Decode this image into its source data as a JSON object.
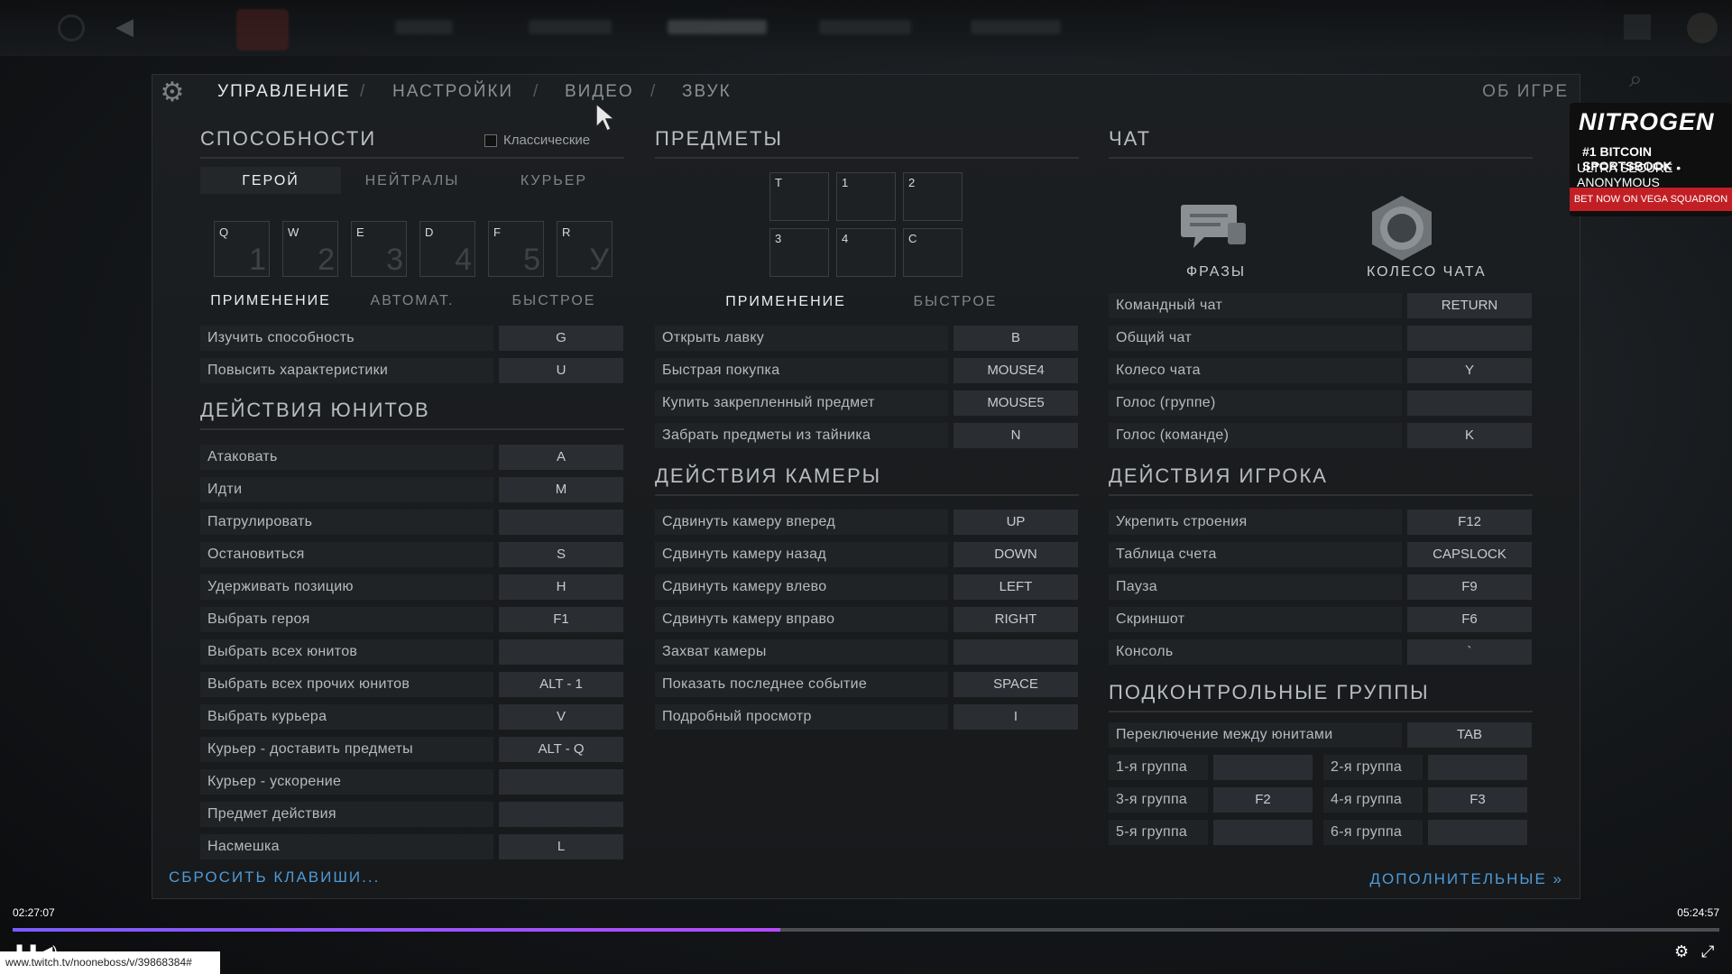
{
  "tabs": {
    "controls": "УПРАВЛЕНИЕ",
    "settings": "НАСТРОЙКИ",
    "video": "ВИДЕО",
    "sound": "ЗВУК",
    "about": "ОБ ИГРЕ",
    "sep": "/"
  },
  "abilities": {
    "title": "СПОСОБНОСТИ",
    "classic_label": "Классические",
    "hero_tabs": [
      "ГЕРОЙ",
      "НЕЙТРАЛЫ",
      "КУРЬЕР"
    ],
    "slots": [
      {
        "key": "Q",
        "num": "1"
      },
      {
        "key": "W",
        "num": "2"
      },
      {
        "key": "E",
        "num": "3"
      },
      {
        "key": "D",
        "num": "4"
      },
      {
        "key": "F",
        "num": "5"
      },
      {
        "key": "R",
        "num": "У"
      }
    ],
    "cast_tabs": [
      "ПРИМЕНЕНИЕ",
      "АВТОМАТ.",
      "БЫСТРОЕ"
    ],
    "rows": [
      {
        "label": "Изучить способность",
        "key": "G"
      },
      {
        "label": "Повысить характеристики",
        "key": "U"
      }
    ]
  },
  "unit_actions": {
    "title": "ДЕЙСТВИЯ ЮНИТОВ",
    "rows": [
      {
        "label": "Атаковать",
        "key": "A"
      },
      {
        "label": "Идти",
        "key": "M"
      },
      {
        "label": "Патрулировать",
        "key": ""
      },
      {
        "label": "Остановиться",
        "key": "S"
      },
      {
        "label": "Удерживать позицию",
        "key": "H"
      },
      {
        "label": "Выбрать героя",
        "key": "F1"
      },
      {
        "label": "Выбрать всех юнитов",
        "key": ""
      },
      {
        "label": "Выбрать всех прочих юнитов",
        "key": "ALT - 1"
      },
      {
        "label": "Выбрать курьера",
        "key": "V"
      },
      {
        "label": "Курьер - доставить предметы",
        "key": "ALT - Q"
      },
      {
        "label": "Курьер - ускорение",
        "key": ""
      },
      {
        "label": "Предмет действия",
        "key": ""
      },
      {
        "label": "Насмешка",
        "key": "L"
      }
    ]
  },
  "items": {
    "title": "ПРЕДМЕТЫ",
    "slots": [
      "T",
      "1",
      "2",
      "3",
      "4",
      "C"
    ],
    "cast_tabs": [
      "ПРИМЕНЕНИЕ",
      "БЫСТРОЕ"
    ],
    "rows": [
      {
        "label": "Открыть лавку",
        "key": "B"
      },
      {
        "label": "Быстрая покупка",
        "key": "MOUSE4"
      },
      {
        "label": "Купить закрепленный предмет",
        "key": "MOUSE5"
      },
      {
        "label": "Забрать предметы из тайника",
        "key": "N"
      }
    ]
  },
  "camera": {
    "title": "ДЕЙСТВИЯ КАМЕРЫ",
    "rows": [
      {
        "label": "Сдвинуть камеру вперед",
        "key": "UP"
      },
      {
        "label": "Сдвинуть камеру назад",
        "key": "DOWN"
      },
      {
        "label": "Сдвинуть камеру влево",
        "key": "LEFT"
      },
      {
        "label": "Сдвинуть камеру вправо",
        "key": "RIGHT"
      },
      {
        "label": "Захват камеры",
        "key": ""
      },
      {
        "label": "Показать последнее событие",
        "key": "SPACE"
      },
      {
        "label": "Подробный просмотр",
        "key": "I"
      }
    ]
  },
  "chat": {
    "title": "ЧАТ",
    "phrases_label": "ФРАЗЫ",
    "wheel_label": "КОЛЕСО ЧАТА",
    "rows": [
      {
        "label": "Командный чат",
        "key": "RETURN"
      },
      {
        "label": "Общий чат",
        "key": ""
      },
      {
        "label": "Колесо чата",
        "key": "Y"
      },
      {
        "label": "Голос (группе)",
        "key": ""
      },
      {
        "label": "Голос (команде)",
        "key": "K"
      }
    ]
  },
  "player_actions": {
    "title": "ДЕЙСТВИЯ ИГРОКА",
    "rows": [
      {
        "label": "Укрепить строения",
        "key": "F12"
      },
      {
        "label": "Таблица счета",
        "key": "CAPSLOCK"
      },
      {
        "label": "Пауза",
        "key": "F9"
      },
      {
        "label": "Скриншот",
        "key": "F6"
      },
      {
        "label": "Консоль",
        "key": "`"
      }
    ]
  },
  "control_groups": {
    "title": "ПОДКОНТРОЛЬНЫЕ ГРУППЫ",
    "switch": {
      "label": "Переключение между юнитами",
      "key": "TAB"
    },
    "groups": [
      {
        "label": "1-я группа",
        "key": ""
      },
      {
        "label": "2-я группа",
        "key": ""
      },
      {
        "label": "3-я группа",
        "key": "F2"
      },
      {
        "label": "4-я группа",
        "key": "F3"
      },
      {
        "label": "5-я группа",
        "key": ""
      },
      {
        "label": "6-я группа",
        "key": ""
      }
    ]
  },
  "footer": {
    "reset": "СБРОСИТЬ КЛАВИШИ...",
    "more": "ДОПОЛНИТЕЛЬНЫЕ »"
  },
  "ad": {
    "brand": "NITROGEN",
    "line1": "#1 BITCOIN SPORTSBOOK",
    "line2": "ULTRA SECURE • ANONYMOUS",
    "cta": "BET NOW ON VEGA SQUADRON"
  },
  "player": {
    "elapsed": "02:27:07",
    "total": "05:24:57",
    "progress_fraction": 0.45,
    "url": "www.twitch.tv/nooneboss/v/39868384#"
  },
  "colors": {
    "accent_link": "#4f9ad6",
    "progress": "#a855f7",
    "ad_red": "#c21f25"
  }
}
